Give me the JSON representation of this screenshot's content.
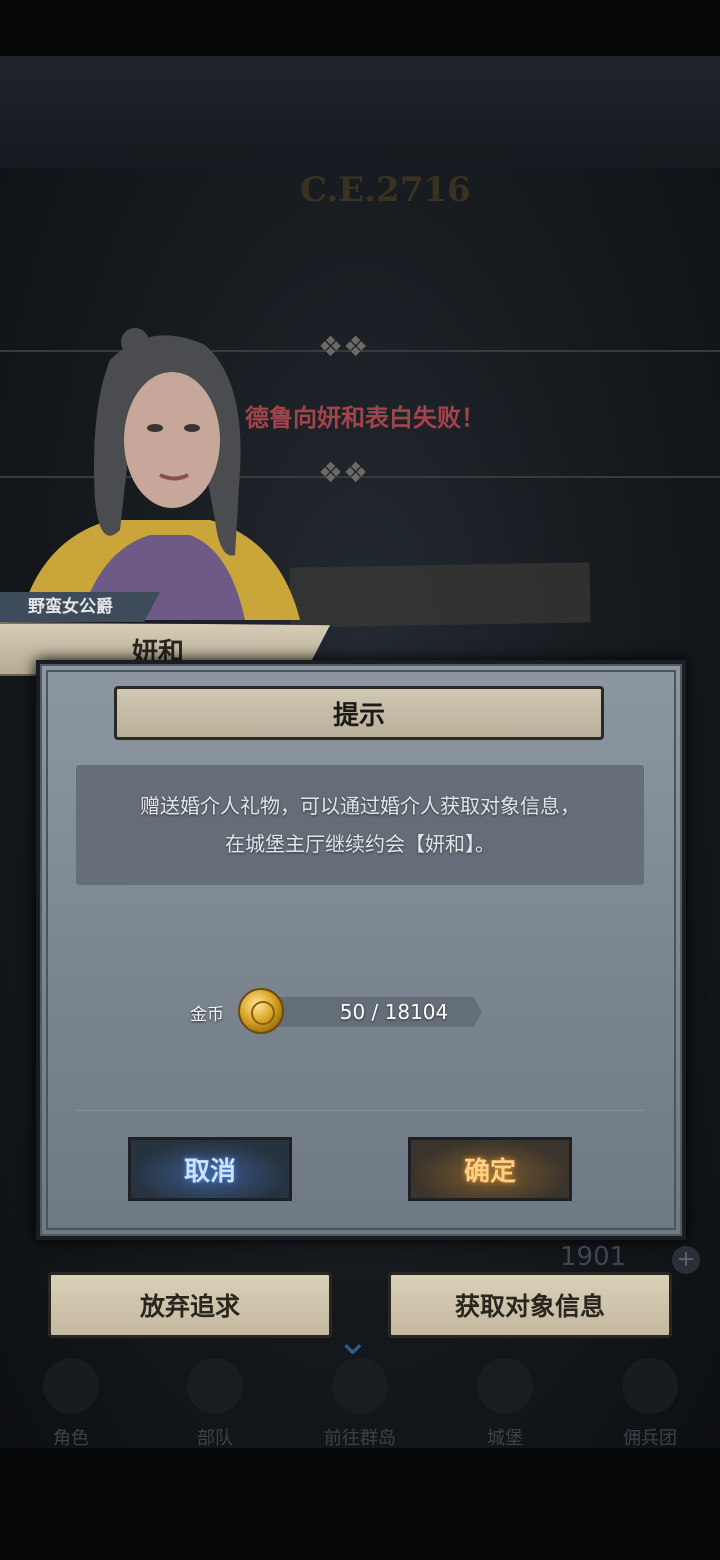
{
  "background": {
    "year": "C.E.2716",
    "event_text": "德鲁向妍和表白失败！",
    "resource_value": "1901"
  },
  "character": {
    "title": "野蛮女公爵",
    "name": "妍和"
  },
  "dialog": {
    "title": "提示",
    "message_line1": "赠送婚介人礼物，可以通过婚介人获取对象信息，",
    "message_line2": "在城堡主厅继续约会【妍和】。",
    "cost_label": "金币",
    "cost_value": "50 / 18104",
    "cancel_label": "取消",
    "confirm_label": "确定"
  },
  "actions": {
    "give_up_label": "放弃追求",
    "get_info_label": "获取对象信息"
  },
  "bottom_nav": [
    "角色",
    "部队",
    "前往群岛",
    "城堡",
    "佣兵团"
  ],
  "colors": {
    "cancel_glow": "#4a8ae0",
    "confirm_glow": "#e09a3a",
    "dialog_bg": "#7b858f"
  }
}
